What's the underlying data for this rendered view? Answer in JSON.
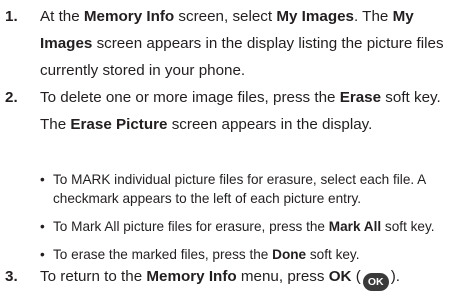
{
  "steps": [
    {
      "number": "1.",
      "lines": [
        [
          "At the ",
          {
            "b": "Memory Info"
          },
          " screen, select ",
          {
            "b": "My Images"
          },
          ". The ",
          {
            "b": "My"
          }
        ],
        [
          {
            "b": "Images"
          },
          " screen appears in the display listing the picture files"
        ],
        [
          "currently stored in your phone."
        ]
      ]
    },
    {
      "number": "2.",
      "lines": [
        [
          "To delete one or more image files, press the ",
          {
            "b": "Erase"
          },
          " soft key."
        ],
        [
          "The ",
          {
            "b": "Erase Picture"
          },
          " screen appears in the display."
        ]
      ],
      "bullets": [
        {
          "lines": [
            [
              "To MARK individual picture files for erasure, select each file. A"
            ],
            [
              "checkmark appears to the left of each picture entry."
            ]
          ]
        },
        {
          "lines": [
            [
              "To Mark All picture files for erasure, press the ",
              {
                "b": "Mark All"
              },
              " soft key."
            ]
          ]
        },
        {
          "lines": [
            [
              "To erase the marked files, press the ",
              {
                "b": "Done"
              },
              " soft key."
            ]
          ]
        }
      ]
    },
    {
      "number": "3.",
      "lines": [
        [
          "To return to the ",
          {
            "b": "Memory Info"
          },
          " menu, press ",
          {
            "b": "OK"
          },
          " (",
          {
            "icon": "ok-key-icon",
            "label": "OK"
          },
          ")."
        ]
      ]
    }
  ],
  "bullet_glyph": "•"
}
